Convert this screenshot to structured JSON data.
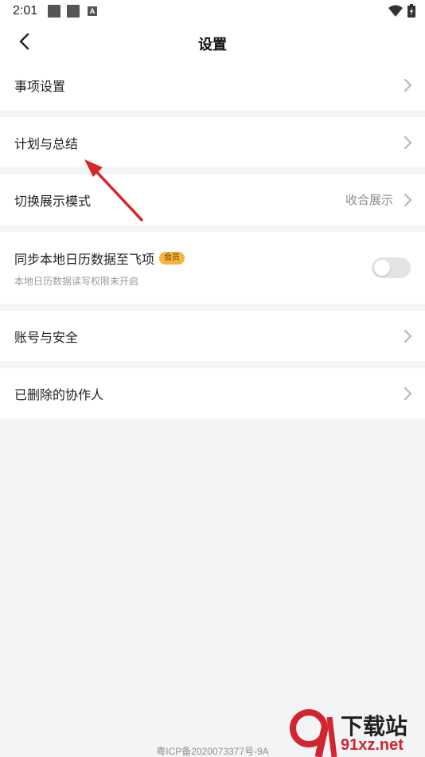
{
  "status_bar": {
    "time": "2:01"
  },
  "header": {
    "title": "设置"
  },
  "settings": {
    "items_settings": {
      "label": "事项设置"
    },
    "plan_summary": {
      "label": "计划与总结"
    },
    "display_mode": {
      "label": "切换展示模式",
      "value": "收合展示"
    },
    "sync_calendar": {
      "label": "同步本地日历数据至飞项",
      "badge": "会员",
      "subtitle": "本地日历数据读写权限未开启",
      "enabled": false
    },
    "account_security": {
      "label": "账号与安全"
    },
    "deleted_collaborators": {
      "label": "已删除的协作人"
    }
  },
  "footer": {
    "icp": "粤ICP备2020073377号-9A"
  },
  "watermark": {
    "main": "下载站",
    "site": "91xz.net"
  },
  "colors": {
    "arrow": "#d8262b",
    "badge": "#f4b63f",
    "background": "#f3f4f6"
  },
  "icons": [
    "back-arrow-icon",
    "chevron-right-icon",
    "wifi-icon",
    "battery-icon",
    "toggle-switch"
  ]
}
